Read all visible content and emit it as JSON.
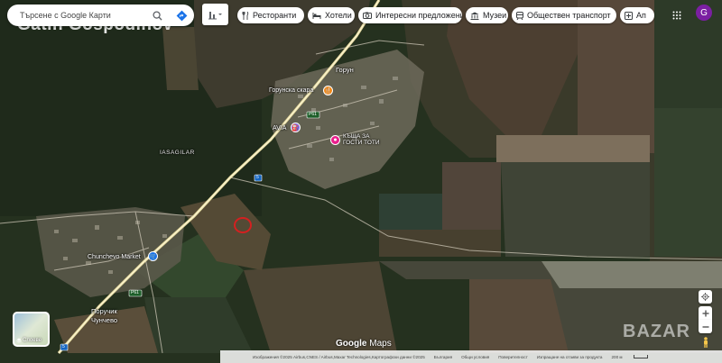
{
  "search": {
    "placeholder": "Търсене с Google Карти"
  },
  "chips": [
    {
      "label": "Ресторанти",
      "icon": "fork-knife-icon"
    },
    {
      "label": "Хотели",
      "icon": "bed-icon"
    },
    {
      "label": "Интересни предложения",
      "icon": "camera-icon"
    },
    {
      "label": "Музеи",
      "icon": "museum-icon"
    },
    {
      "label": "Обществен транспорт",
      "icon": "train-icon"
    },
    {
      "label": "Ап",
      "icon": "pharmacy-icon"
    }
  ],
  "account": {
    "initial": "G"
  },
  "watermark": "Gatin Gospodinov",
  "map_labels": {
    "village_gorun": "Горун",
    "village_poruchik": "Поручик\nЧунчево",
    "area_iasagilar": "IASAGILAR",
    "poi_grill": "Горунска скара",
    "poi_avia": "AVIA",
    "poi_guesthouse": "КЪЩА ЗА\nГОСТИ ТОТИ",
    "poi_market": "Chunchevo Market",
    "road_p61": "Р61",
    "road_5": "5"
  },
  "layers": {
    "label": "Слоеве"
  },
  "logo": {
    "google": "Google",
    "maps": "Maps"
  },
  "footer": {
    "imagery": "Изображения ©2025 Airbus,CNES / Airbus,Maxar Technologies,Картографски данни ©2025",
    "country": "България",
    "terms": "Общи условия",
    "privacy": "Поверителност",
    "feedback": "Изпращане на отзиви за продукта",
    "scale": "200 м"
  },
  "bazar_watermark": "BAZAR",
  "colors": {
    "forest": "#24301f",
    "fields": "#4e4a35",
    "pink_poi": "#e91e8c",
    "orange_poi": "#f28a1b",
    "purple_poi": "#7b68ee",
    "blue_poi": "#1a73e8",
    "avatar": "#7b1fa2"
  }
}
